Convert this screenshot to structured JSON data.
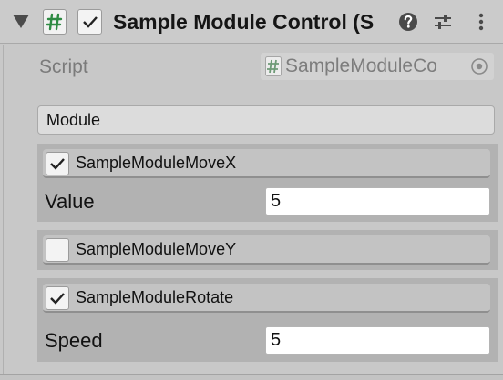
{
  "header": {
    "title": "Sample Module Control (S",
    "script_icon_glyph": "#",
    "enabled": true,
    "icons": [
      "foldout-triangle-icon",
      "script-icon",
      "help-icon",
      "presets-icon",
      "kebab-menu-icon"
    ]
  },
  "script_field": {
    "label": "Script",
    "value": "SampleModuleCo",
    "icon_glyph": "#"
  },
  "module_list": {
    "header": "Module",
    "items": [
      {
        "name": "SampleModuleMoveX",
        "enabled": true,
        "property_label": "Value",
        "property_value": "5"
      },
      {
        "name": "SampleModuleMoveY",
        "enabled": false
      },
      {
        "name": "SampleModuleRotate",
        "enabled": true,
        "property_label": "Speed",
        "property_value": "5"
      }
    ]
  },
  "colors": {
    "background": "#c8c8c8",
    "script_icon_green": "#2e8b43",
    "text": "#111111",
    "muted_text": "#7b7b7b",
    "module_box": "#b2b2b2"
  }
}
